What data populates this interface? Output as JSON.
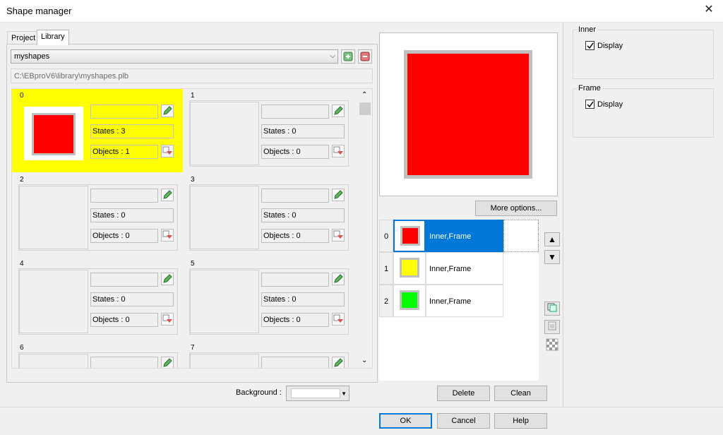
{
  "window": {
    "title": "Shape manager"
  },
  "tabs": [
    "Project",
    "Library"
  ],
  "library": {
    "selected": "myshapes",
    "path": "C:\\EBproV6\\library\\myshapes.plb"
  },
  "shapes": [
    {
      "index": "0",
      "states": "States : 3",
      "objects": "Objects : 1",
      "selected": true
    },
    {
      "index": "1",
      "states": "States : 0",
      "objects": "Objects : 0"
    },
    {
      "index": "2",
      "states": "States : 0",
      "objects": "Objects : 0"
    },
    {
      "index": "3",
      "states": "States : 0",
      "objects": "Objects : 0"
    },
    {
      "index": "4",
      "states": "States : 0",
      "objects": "Objects : 0"
    },
    {
      "index": "5",
      "states": "States : 0",
      "objects": "Objects : 0"
    },
    {
      "index": "6"
    },
    {
      "index": "7"
    }
  ],
  "preview": {
    "fill_color": "#ff0000",
    "frame_color": "#c0c0c0"
  },
  "more_options_label": "More options...",
  "states_list": [
    {
      "index": "0",
      "label": "Inner,Frame",
      "color": "#ff0000",
      "active": true
    },
    {
      "index": "1",
      "label": "Inner,Frame",
      "color": "#ffff00"
    },
    {
      "index": "2",
      "label": "Inner,Frame",
      "color": "#00ff00"
    }
  ],
  "buttons": {
    "delete": "Delete",
    "clean": "Clean",
    "ok": "OK",
    "cancel": "Cancel",
    "help": "Help"
  },
  "background": {
    "label": "Background :"
  },
  "inner_group": {
    "title": "Inner",
    "display_label": "Display",
    "checked": true
  },
  "frame_group": {
    "title": "Frame",
    "display_label": "Display",
    "checked": true
  },
  "icons": {
    "close": "close-icon",
    "add_library": "add-library-icon",
    "delete_library": "delete-library-icon",
    "edit": "pencil-icon",
    "objects": "objects-icon",
    "up": "arrow-up-icon",
    "down": "arrow-down-icon",
    "copy": "copy-state-icon",
    "paste": "paste-state-icon",
    "transparent": "transparent-icon"
  }
}
